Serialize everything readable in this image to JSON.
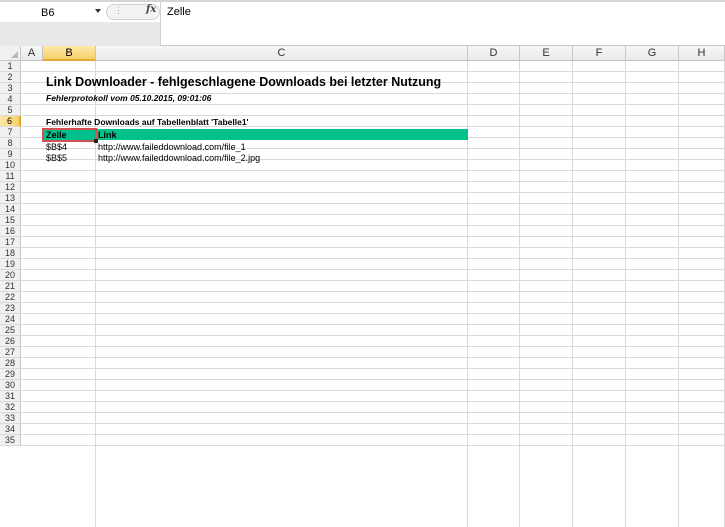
{
  "formula_bar": {
    "name_box": "B6",
    "fx_label": "fx",
    "formula": "Zelle"
  },
  "columns": [
    "A",
    "B",
    "C",
    "D",
    "E",
    "F",
    "G",
    "H"
  ],
  "rows": [
    "1",
    "2",
    "3",
    "4",
    "5",
    "6",
    "7",
    "8",
    "9",
    "10",
    "11",
    "12",
    "13",
    "14",
    "15",
    "16",
    "17",
    "18",
    "19",
    "20",
    "21",
    "22",
    "23",
    "24",
    "25",
    "26",
    "27",
    "28",
    "29",
    "30",
    "31",
    "32",
    "33",
    "34",
    "35"
  ],
  "selected": {
    "column": "B",
    "row": "6"
  },
  "sheet": {
    "title": "Link Downloader - fehlgeschlagene Downloads bei letzter Nutzung",
    "subtitle": "Fehlerprotokoll vom 05.10.2015, 09:01:06",
    "section_heading": "Fehlerhafte Downloads auf Tabellenblatt 'Tabelle1'",
    "header": {
      "cell": "Zelle",
      "link": "Link"
    },
    "rows": [
      {
        "cell": "$B$4",
        "link": "http://www.faileddownload.com/file_1"
      },
      {
        "cell": "$B$5",
        "link": "http://www.faileddownload.com/file_2.jpg"
      }
    ]
  },
  "colors": {
    "header_fill": "#00c08b",
    "selection_border": "#d25252",
    "selected_header": "#f8cf6a"
  }
}
